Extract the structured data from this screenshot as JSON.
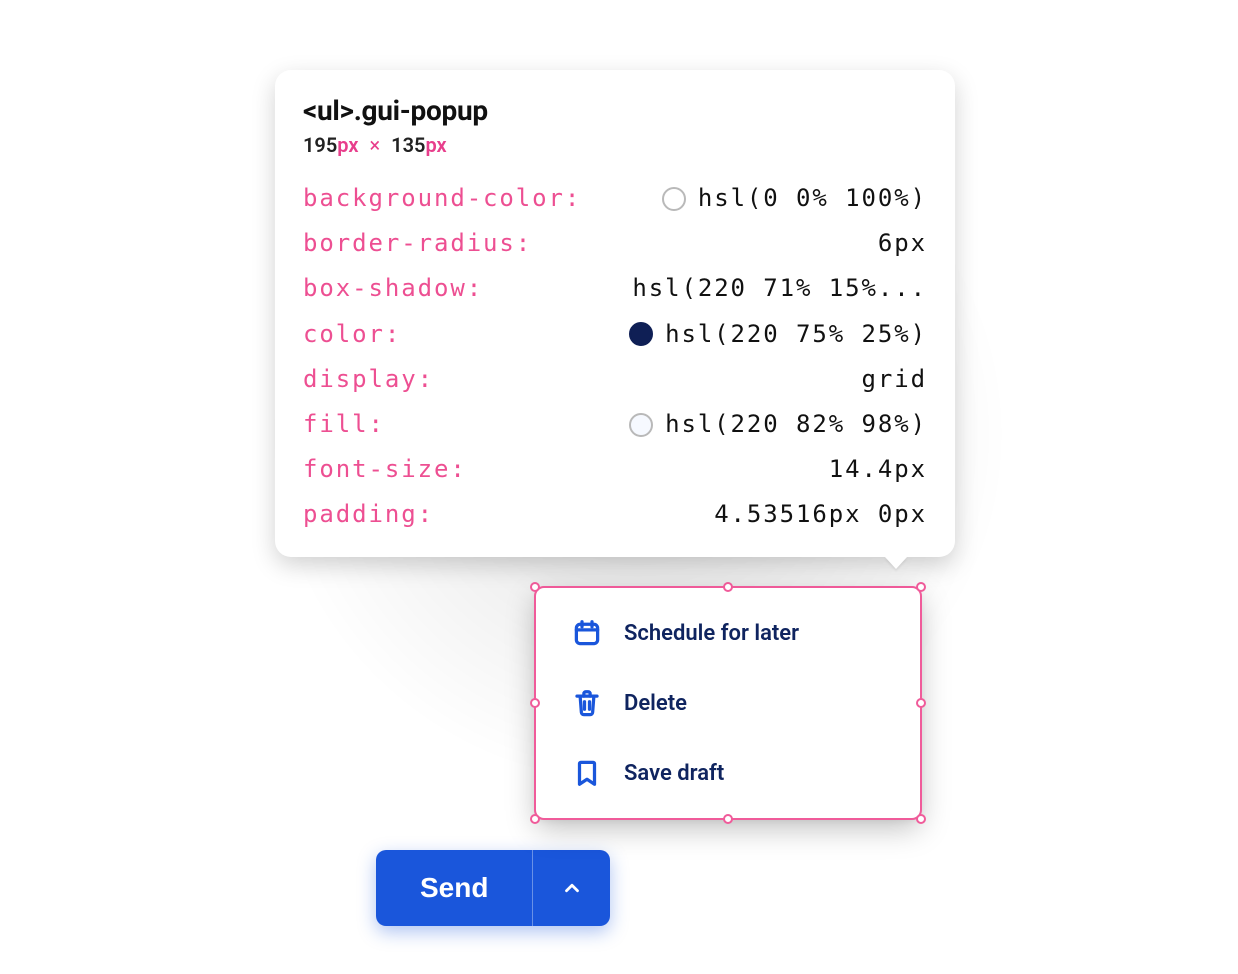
{
  "tooltip": {
    "selector_tag": "<ul>",
    "selector_class": ".gui-popup",
    "width_num": "195",
    "height_num": "135",
    "px_suffix": "px",
    "times": "×",
    "rows": [
      {
        "key": "background-color:",
        "val": "hsl(0 0% 100%)",
        "swatch": "white"
      },
      {
        "key": "border-radius:",
        "val": "6px",
        "swatch": null
      },
      {
        "key": "box-shadow:",
        "val": "hsl(220 71% 15%...",
        "swatch": null
      },
      {
        "key": "color:",
        "val": "hsl(220 75% 25%)",
        "swatch": "dark"
      },
      {
        "key": "display:",
        "val": "grid",
        "swatch": null
      },
      {
        "key": "fill:",
        "val": "hsl(220 82% 98%)",
        "swatch": "light"
      },
      {
        "key": "font-size:",
        "val": "14.4px",
        "swatch": null
      },
      {
        "key": "padding:",
        "val": "4.53516px 0px",
        "swatch": null
      }
    ]
  },
  "popup": {
    "items": [
      {
        "label": "Schedule for later",
        "icon": "calendar-icon"
      },
      {
        "label": "Delete",
        "icon": "trash-icon"
      },
      {
        "label": "Save draft",
        "icon": "bookmark-icon"
      }
    ]
  },
  "send": {
    "label": "Send"
  }
}
